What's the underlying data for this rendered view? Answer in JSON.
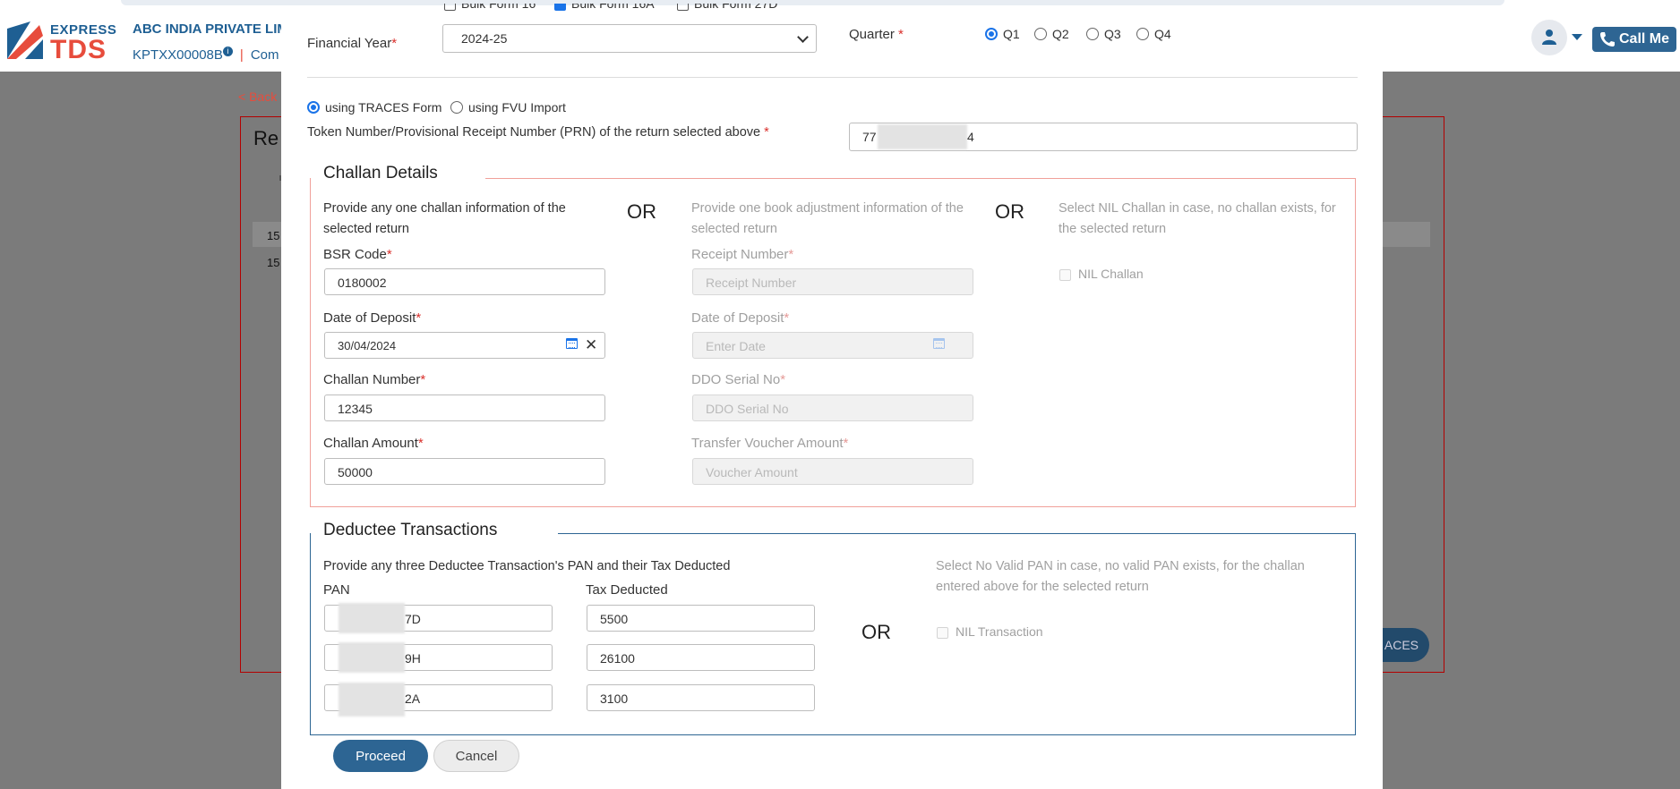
{
  "app": {
    "brand_top": "EXPRESS",
    "brand_bottom": "TDS",
    "company_name": "ABC INDIA PRIVATE LIM",
    "tan": "KPTXX00008B",
    "sub_link": "Com",
    "call_me": "Call Me",
    "back_link": "< Back",
    "bg_heading": "Re",
    "bg_row1": "15",
    "bg_row2": "15",
    "bg_traces_button": "ACES"
  },
  "form": {
    "bulk_options": [
      {
        "label": "Bulk Form 16",
        "checked": false
      },
      {
        "label": "Bulk Form 16A",
        "checked": true
      },
      {
        "label": "Bulk Form 27D",
        "checked": false
      }
    ],
    "financial_year_label": "Financial Year",
    "financial_year_value": "2024-25",
    "quarter_label": "Quarter",
    "quarters": [
      "Q1",
      "Q2",
      "Q3",
      "Q4"
    ],
    "selected_quarter": "Q1",
    "method_traces": "using TRACES Form",
    "method_fvu": "using FVU Import",
    "token_label": "Token Number/Provisional Receipt Number (PRN) of the return selected above",
    "token_value_start": "77",
    "token_value_end": "4"
  },
  "challan": {
    "legend": "Challan Details",
    "desc_challan": "Provide any one challan information of the selected return",
    "desc_book": "Provide one book adjustment information of the selected return",
    "desc_nil": "Select NIL Challan in case, no challan exists, for the selected return",
    "or": "OR",
    "bsr_label": "BSR Code",
    "bsr_value": "0180002",
    "dod_label": "Date of Deposit",
    "dod_value": "30/04/2024",
    "challan_no_label": "Challan Number",
    "challan_no_value": "12345",
    "amount_label": "Challan Amount",
    "amount_value": "50000",
    "receipt_label": "Receipt Number",
    "receipt_placeholder": "Receipt Number",
    "book_dod_label": "Date of Deposit",
    "book_dod_placeholder": "Enter Date",
    "ddo_label": "DDO Serial No",
    "ddo_placeholder": "DDO Serial No",
    "voucher_label": "Transfer Voucher Amount",
    "voucher_placeholder": "Voucher Amount",
    "nil_challan": "NIL Challan"
  },
  "deductee": {
    "legend": "Deductee Transactions",
    "desc": "Provide any three Deductee Transaction's PAN and their Tax Deducted",
    "desc_nil": "Select No Valid PAN in case, no valid PAN exists, for the challan entered above for the selected return",
    "pan_label": "PAN",
    "tax_label": "Tax Deducted",
    "or": "OR",
    "rows": [
      {
        "pan_suffix": "7D",
        "tax": "5500"
      },
      {
        "pan_suffix": "9H",
        "tax": "26100"
      },
      {
        "pan_suffix": "2A",
        "tax": "3100"
      }
    ],
    "nil_transaction": "NIL Transaction"
  },
  "buttons": {
    "proceed": "Proceed",
    "cancel": "Cancel"
  },
  "colors": {
    "primary": "#2d6593",
    "accent_red": "#e74c3c",
    "challan_border": "#f0a09a",
    "deductee_border": "#2d6593"
  }
}
